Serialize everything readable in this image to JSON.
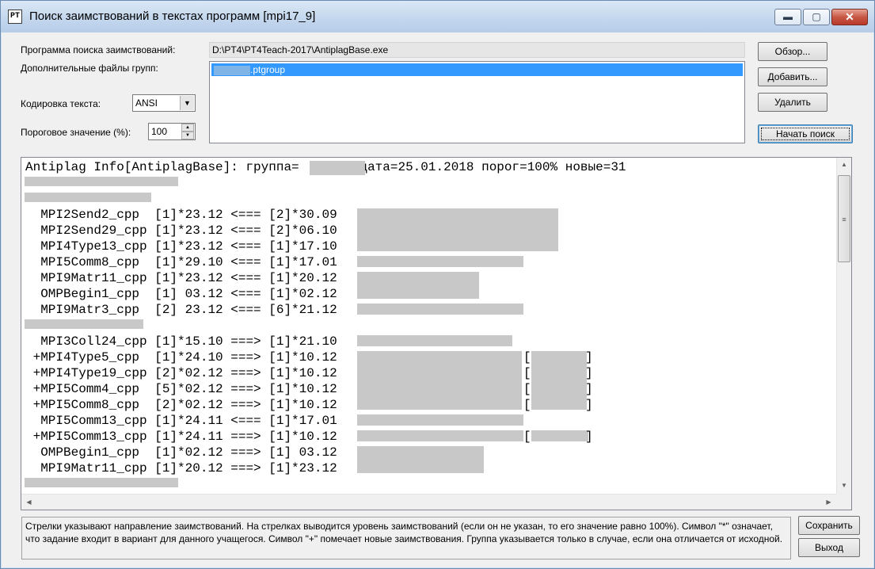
{
  "window": {
    "title": "Поиск заимствований в текстах программ  [mpi17_9]",
    "icon_glyph": "PT",
    "controls": {
      "minimize": "▬",
      "maximize": "▢",
      "close": "✕"
    }
  },
  "settings": {
    "program_label": "Программа поиска заимствований:",
    "program_path": "D:\\PT4\\PT4Teach-2017\\AntiplagBase.exe",
    "extra_files_label": "Дополнительные файлы групп:",
    "extra_files": [
      ".ptgroup"
    ],
    "encoding_label": "Кодировка текста:",
    "encoding_value": "ANSI",
    "threshold_label": "Пороговое значение (%):",
    "threshold_value": "100"
  },
  "buttons": {
    "browse": "Обзор...",
    "add": "Добавить...",
    "delete": "Удалить",
    "start_search": "Начать поиск",
    "save": "Сохранить",
    "exit": "Выход"
  },
  "output": {
    "header": "Antiplag Info[AntiplagBase]: группа=        дата=25.01.2018 порог=100% новые=31",
    "lines": [
      "  MPI2Send2_cpp  [1]*23.12 <=== [2]*30.09",
      "  MPI2Send29_cpp [1]*23.12 <=== [2]*06.10",
      "  MPI4Type13_cpp [1]*23.12 <=== [1]*17.10",
      "  MPI5Comm8_cpp  [1]*29.10 <=== [1]*17.01",
      "  MPI9Matr11_cpp [1]*23.12 <=== [1]*20.12",
      "  OMPBegin1_cpp  [1] 03.12 <=== [1]*02.12",
      "  MPI9Matr3_cpp  [2] 23.12 <=== [6]*21.12",
      "  MPI3Coll24_cpp [1]*15.10 ===> [1]*21.10",
      " +MPI4Type5_cpp  [1]*24.10 ===> [1]*10.12",
      " +MPI4Type19_cpp [2]*02.12 ===> [1]*10.12",
      " +MPI5Comm4_cpp  [5]*02.12 ===> [1]*10.12",
      " +MPI5Comm8_cpp  [2]*02.12 ===> [1]*10.12",
      "  MPI5Comm13_cpp [1]*24.11 <=== [1]*17.01",
      " +MPI5Comm13_cpp [1]*24.11 ===> [1]*10.12",
      "  OMPBegin1_cpp  [1]*02.12 ===> [1] 03.12",
      "  MPI9Matr11_cpp [1]*20.12 ===> [1]*23.12"
    ],
    "bracket_rows": [
      "[",
      "]"
    ]
  },
  "scrollbar": {
    "up": "▲",
    "down": "▼",
    "left": "◀",
    "right": "▶",
    "grip": "≡"
  },
  "info_text": "Стрелки указывают направление заимствований. На стрелках выводится уровень заимствований (если он не указан, то его значение равно 100%). Символ \"*\" означает, что задание входит в вариант для данного учащегося. Символ \"+\" помечает новые заимствования. Группа указывается только в случае, если она отличается от исходной.",
  "colors": {
    "selection": "#3399ff",
    "redaction": "#c8c8c8",
    "titlebar": "#c2d6ed"
  }
}
